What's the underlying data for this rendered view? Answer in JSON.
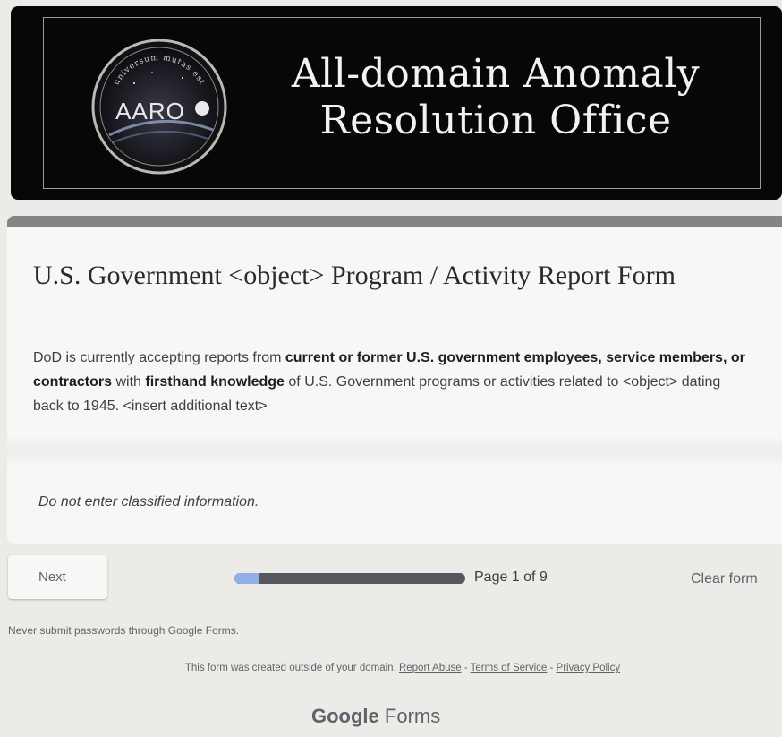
{
  "banner": {
    "seal_text": "AARO",
    "seal_motto": "universum mutas est",
    "title_line1": "All-domain Anomaly",
    "title_line2": "Resolution Office"
  },
  "form": {
    "title": "U.S. Government  <object> Program / Activity Report Form",
    "description": {
      "t1": "DoD is currently accepting reports from ",
      "b1": "current or former U.S. government employees, service members, or contractors",
      "t2": " with ",
      "b2": "firsthand knowledge",
      "t3": " of U.S. Government programs or activities related to <object> dating back to 1945.   <insert additional text>"
    },
    "note": "Do not enter classified information."
  },
  "navigation": {
    "next_label": "Next",
    "page_label": "Page 1 of 9",
    "progress_fraction": 0.11,
    "clear_label": "Clear form"
  },
  "footer": {
    "warning": "Never submit passwords through Google Forms.",
    "created_text": "This form was created outside of your domain.",
    "report_abuse": "Report Abuse",
    "sep": " - ",
    "terms": "Terms of Service",
    "privacy": "Privacy Policy",
    "brand_google": "Google",
    "brand_forms": "Forms"
  },
  "colors": {
    "banner_bg": "#070707",
    "card_accent": "#858585",
    "progress_fill": "#8fb0e4",
    "progress_track": "#56565e"
  }
}
